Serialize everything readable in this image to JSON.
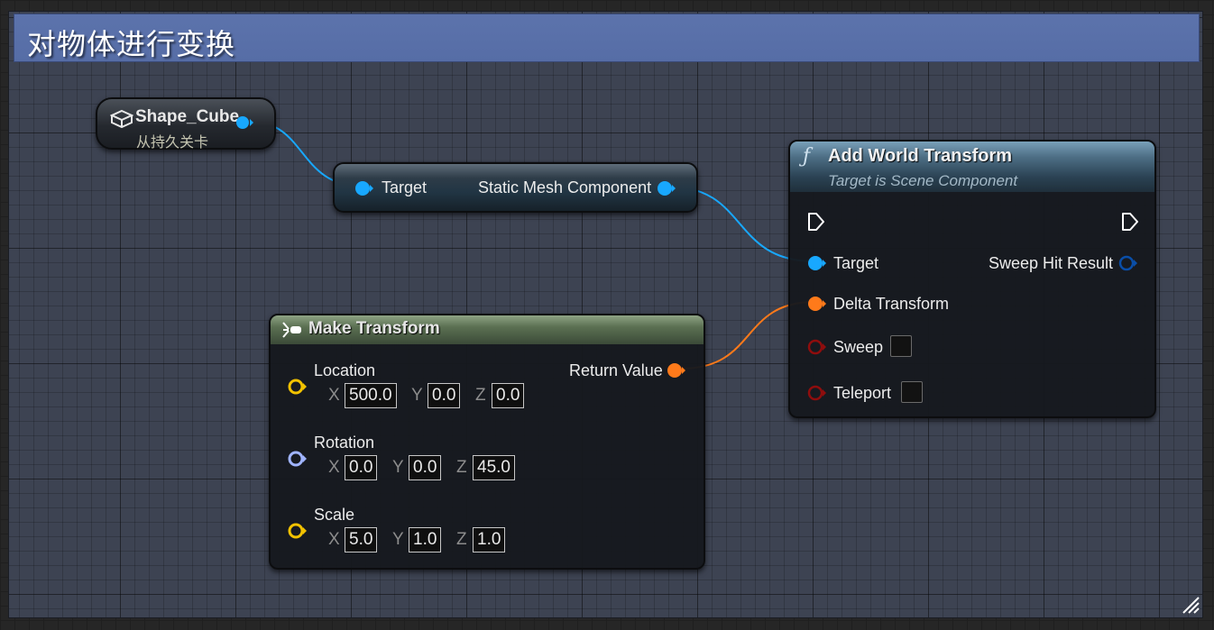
{
  "comment": {
    "title": "对物体进行变换",
    "color": "#5a70a8"
  },
  "shape_node": {
    "title": "Shape_Cube",
    "subtitle": "从持久关卡",
    "icon": "cube-icon"
  },
  "get_node": {
    "input_label": "Target",
    "output_label": "Static Mesh Component"
  },
  "add_world_transform": {
    "title": "Add World Transform",
    "subtitle": "Target is Scene Component",
    "icon": "function-icon",
    "pins": {
      "target": "Target",
      "delta_transform": "Delta Transform",
      "sweep": "Sweep",
      "teleport": "Teleport",
      "sweep_hit_result": "Sweep Hit Result"
    },
    "sweep_checked": false,
    "teleport_checked": false
  },
  "make_transform": {
    "title": "Make Transform",
    "icon": "make-struct-icon",
    "return_label": "Return Value",
    "axis_labels": {
      "x": "X",
      "y": "Y",
      "z": "Z"
    },
    "location": {
      "label": "Location",
      "x": "500.0",
      "y": "0.0",
      "z": "0.0"
    },
    "rotation": {
      "label": "Rotation",
      "x": "0.0",
      "y": "0.0",
      "z": "45.0"
    },
    "scale": {
      "label": "Scale",
      "x": "5.0",
      "y": "1.0",
      "z": "1.0"
    }
  },
  "colors": {
    "object_pin": "#18a8ff",
    "transform_pin": "#ff7a1a",
    "vector_pin": "#f2c200",
    "rotator_pin": "#a0b4ff",
    "bool_pin": "#8f0d0d",
    "struct_pin": "#0a4ea8",
    "exec_pin": "#ffffff"
  }
}
